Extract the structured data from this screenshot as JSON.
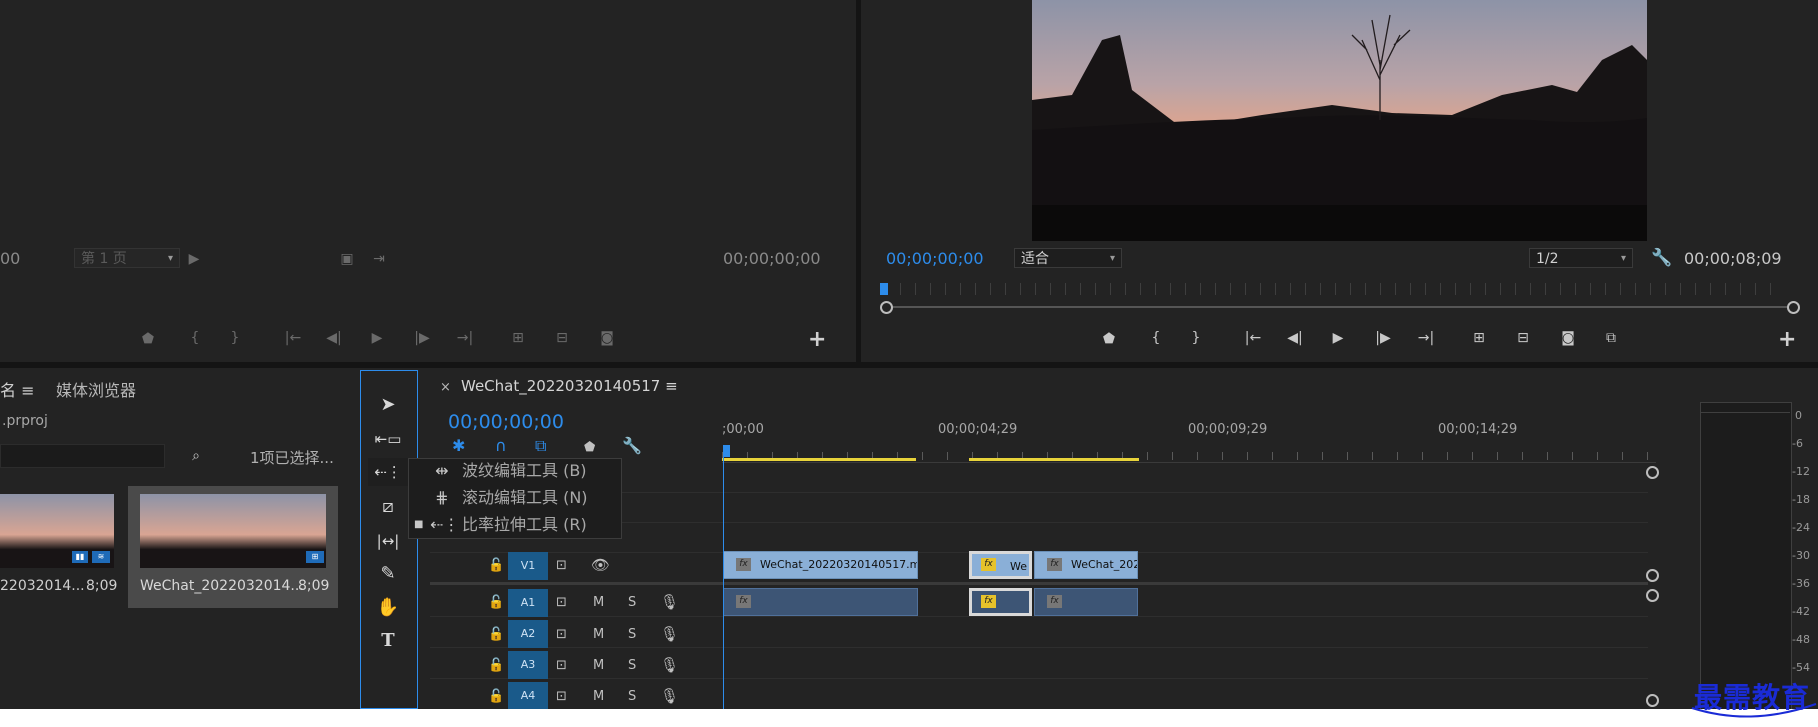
{
  "source_monitor": {
    "timecode_left": "00",
    "page_select": "第 1 页",
    "timecode_right": "00;00;00;00"
  },
  "program_monitor": {
    "timecode_current": "00;00;00;00",
    "fit_select": "适合",
    "resolution_select": "1/2",
    "timecode_duration": "00;00;08;09"
  },
  "project_panel": {
    "tab_name_partial": "名",
    "tab_media_browser": "媒体浏览器",
    "project_file": ".prproj",
    "selection_info": "1项已选择...",
    "items": [
      {
        "name": "22032014...",
        "duration": "8;09"
      },
      {
        "name": "WeChat_2022032014...",
        "duration": "8;09"
      }
    ]
  },
  "timeline": {
    "sequence_name": "WeChat_20220320140517",
    "timecode": "00;00;00;00",
    "ruler_labels": [
      ";00;00",
      "00;00;04;29",
      "00;00;09;29",
      "00;00;14;29"
    ],
    "tracks": {
      "video": [
        {
          "label": "V1"
        }
      ],
      "audio": [
        {
          "label": "A1",
          "mute": "M",
          "solo": "S"
        },
        {
          "label": "A2",
          "mute": "M",
          "solo": "S"
        },
        {
          "label": "A3",
          "mute": "M",
          "solo": "S"
        },
        {
          "label": "A4",
          "mute": "M",
          "solo": "S"
        }
      ]
    },
    "clips": {
      "v1": [
        "WeChat_20220320140517.mp",
        "We",
        "WeChat_202"
      ]
    }
  },
  "tool_flyout": {
    "items": [
      {
        "label": "波纹编辑工具 (B)",
        "checked": false
      },
      {
        "label": "滚动编辑工具 (N)",
        "checked": false
      },
      {
        "label": "比率拉伸工具 (R)",
        "checked": true
      }
    ]
  },
  "audio_meter": {
    "ticks": [
      "0",
      "-6",
      "-12",
      "-18",
      "-24",
      "-30",
      "-36",
      "-42",
      "-48",
      "-54"
    ]
  },
  "watermark": "最需教育",
  "colors": {
    "accent_blue": "#2d8ceb",
    "clip_video": "#8aafd7",
    "clip_audio": "#3d5575",
    "work_area": "#e8d33a",
    "watermark": "#1a2bd6"
  }
}
